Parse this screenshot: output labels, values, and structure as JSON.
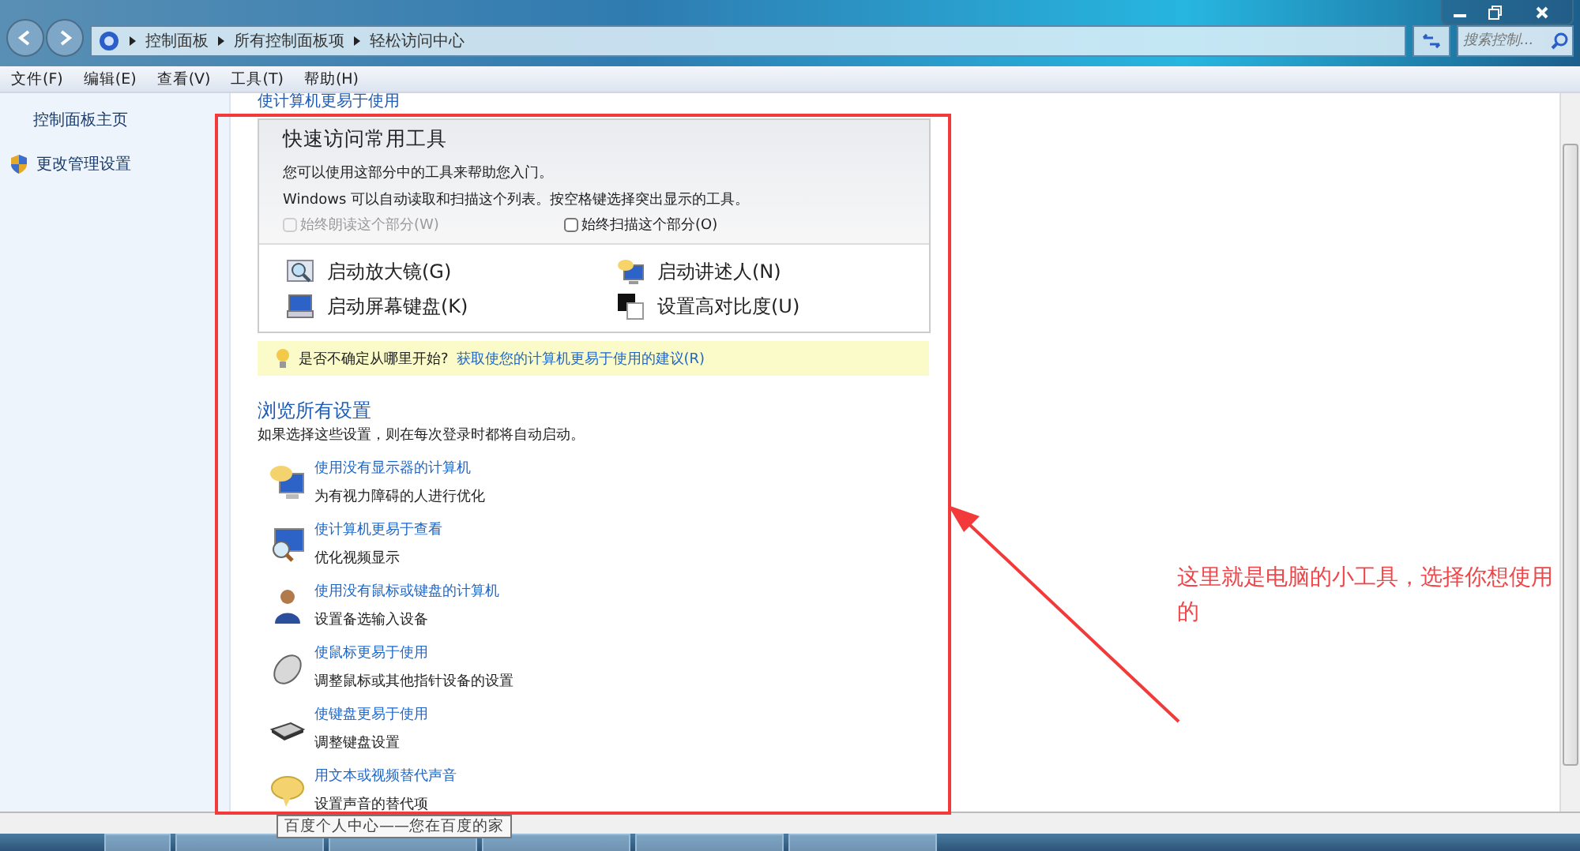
{
  "address_bar": {
    "crumbs": [
      "控制面板",
      "所有控制面板项",
      "轻松访问中心"
    ],
    "search_placeholder": "搜索控制..."
  },
  "menu": [
    "文件(F)",
    "编辑(E)",
    "查看(V)",
    "工具(T)",
    "帮助(H)"
  ],
  "sidebar": {
    "items": [
      {
        "label": "控制面板主页",
        "kind": "link"
      },
      {
        "label": "更改管理设置",
        "kind": "shield"
      }
    ]
  },
  "page_heading": "使计算机更易于使用",
  "quick_access": {
    "title": "快速访问常用工具",
    "intro": "您可以使用这部分中的工具来帮助您入门。",
    "note": "Windows 可以自动读取和扫描这个列表。按空格键选择突出显示的工具。",
    "options": [
      {
        "label": "始终朗读这个部分(W)",
        "checked": false,
        "disabled": true
      },
      {
        "label": "始终扫描这个部分(O)",
        "checked": false,
        "disabled": false
      }
    ],
    "tools": [
      {
        "label": "启动放大镜(G)",
        "kind": "magnifier"
      },
      {
        "label": "启动讲述人(N)",
        "kind": "narrator"
      },
      {
        "label": "启动屏幕键盘(K)",
        "kind": "keyboard"
      },
      {
        "label": "设置高对比度(U)",
        "kind": "contrast"
      }
    ]
  },
  "tip": {
    "text": "是否不确定从哪里开始?",
    "link": "获取使您的计算机更易于使用的建议(R)"
  },
  "browse": {
    "title": "浏览所有设置",
    "subtitle": "如果选择这些设置，则在每次登录时都将自动启动。",
    "items": [
      {
        "link": "使用没有显示器的计算机",
        "desc": "为有视力障碍的人进行优化",
        "kind": "speech-monitor"
      },
      {
        "link": "使计算机更易于查看",
        "desc": "优化视频显示",
        "kind": "monitor-magnifier"
      },
      {
        "link": "使用没有鼠标或键盘的计算机",
        "desc": "设置备选输入设备",
        "kind": "person"
      },
      {
        "link": "使鼠标更易于使用",
        "desc": "调整鼠标或其他指针设备的设置",
        "kind": "mouse"
      },
      {
        "link": "使键盘更易于使用",
        "desc": "调整键盘设置",
        "kind": "keyboard"
      },
      {
        "link": "用文本或视频替代声音",
        "desc": "设置声音的替代项",
        "kind": "speech"
      }
    ]
  },
  "tooltip": "百度个人中心——您在百度的家",
  "annotation": "这里就是电脑的小工具，选择你想使用的"
}
